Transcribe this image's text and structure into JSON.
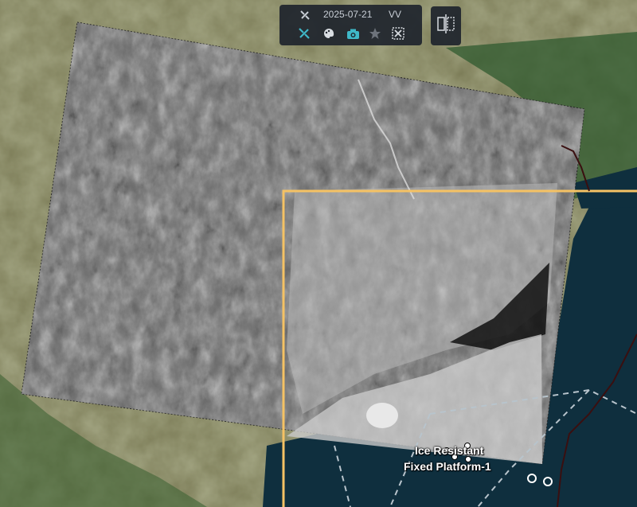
{
  "toolbar": {
    "date": "2025-07-21",
    "polarization": "VV",
    "icons": [
      "satellite-icon",
      "measure-icon",
      "palette-icon",
      "camera-icon",
      "star-icon",
      "scissors-icon"
    ],
    "accent": "#3fb8c8"
  },
  "side_panel": {
    "icon": "compare-split-icon"
  },
  "platform": {
    "label_line1": "Ice Resistant",
    "label_line2": "Fixed Platform-1"
  },
  "colors": {
    "aoi_outline": "#f5c264",
    "sea": "#0f2f3e",
    "land": "#6e7a4f"
  }
}
